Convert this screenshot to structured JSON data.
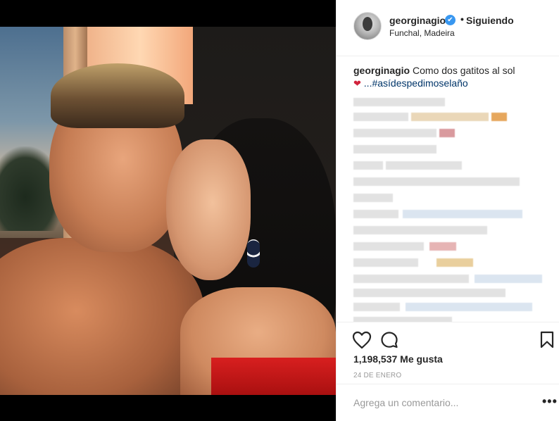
{
  "post": {
    "username": "georginagio",
    "verified_mark": "✔",
    "separator": "•",
    "follow_status": "Siguiendo",
    "location": "Funchal, Madeira",
    "caption_user": "georginagio",
    "caption_text": "Como dos gatitos al sol",
    "caption_emoji": "❤",
    "caption_tag": "...#asídespedimoselaño",
    "likes": "1,198,537 Me gusta",
    "date": "24 DE ENERO",
    "comment_placeholder": "Agrega un comentario...",
    "more_label": "•••"
  },
  "icons": {
    "like": "heart-outline-icon",
    "comment": "comment-bubble-icon",
    "save": "bookmark-icon",
    "verified": "verified-badge-icon"
  },
  "colors": {
    "link": "#003569",
    "verified": "#3897f0",
    "muted": "#999999",
    "text": "#262626"
  }
}
